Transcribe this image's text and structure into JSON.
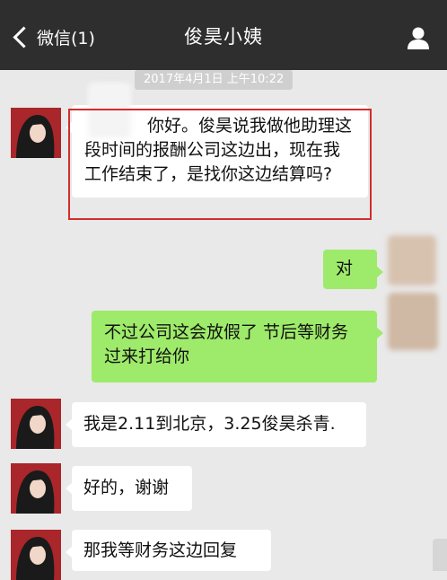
{
  "header": {
    "back_label": "微信(1)",
    "title": "俊昊小姨"
  },
  "timestamp": "2017年4月1日 上午10:22",
  "messages": [
    {
      "side": "left",
      "text": "你好。俊昊说我做他助理这段时间的报酬公司这边出，现在我工作结束了，是找你这边结算吗?"
    },
    {
      "side": "right",
      "text": "对"
    },
    {
      "side": "right",
      "text": "不过公司这会放假了 节后等财务过来打给你"
    },
    {
      "side": "left",
      "text": "我是2.11到北京，3.25俊昊杀青."
    },
    {
      "side": "left",
      "text": "好的，谢谢"
    },
    {
      "side": "left",
      "text": "那我等财务这边回复"
    }
  ],
  "colors": {
    "header_bg": "#2e2e2e",
    "chat_bg": "#e9e9e9",
    "sent_bubble": "#9eea6a",
    "received_bubble": "#ffffff",
    "highlight_border": "#d62b2b"
  }
}
